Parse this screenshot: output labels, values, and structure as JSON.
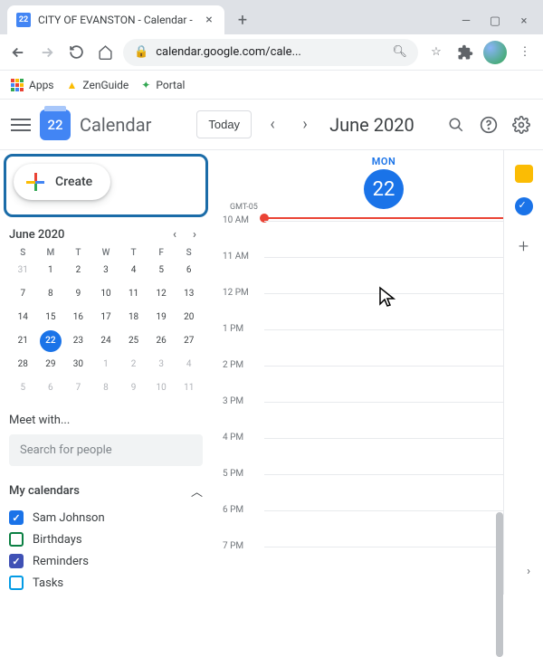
{
  "browser": {
    "tab_title": "CITY OF EVANSTON - Calendar -",
    "favicon_day": "22",
    "url_display": "calendar.google.com/cale...",
    "bookmarks": {
      "apps": "Apps",
      "zenguide": "ZenGuide",
      "portal": "Portal"
    }
  },
  "header": {
    "logo_day": "22",
    "app_name": "Calendar",
    "today_label": "Today",
    "month_label": "June 2020"
  },
  "mini": {
    "month": "June 2020",
    "dows": [
      "S",
      "M",
      "T",
      "W",
      "T",
      "F",
      "S"
    ],
    "weeks": [
      [
        {
          "n": "31",
          "o": true
        },
        {
          "n": "1"
        },
        {
          "n": "2"
        },
        {
          "n": "3"
        },
        {
          "n": "4"
        },
        {
          "n": "5"
        },
        {
          "n": "6"
        }
      ],
      [
        {
          "n": "7"
        },
        {
          "n": "8"
        },
        {
          "n": "9"
        },
        {
          "n": "10"
        },
        {
          "n": "11"
        },
        {
          "n": "12"
        },
        {
          "n": "13"
        }
      ],
      [
        {
          "n": "14"
        },
        {
          "n": "15"
        },
        {
          "n": "16"
        },
        {
          "n": "17"
        },
        {
          "n": "18"
        },
        {
          "n": "19"
        },
        {
          "n": "20"
        }
      ],
      [
        {
          "n": "21"
        },
        {
          "n": "22",
          "t": true
        },
        {
          "n": "23"
        },
        {
          "n": "24"
        },
        {
          "n": "25"
        },
        {
          "n": "26"
        },
        {
          "n": "27"
        }
      ],
      [
        {
          "n": "28"
        },
        {
          "n": "29"
        },
        {
          "n": "30"
        },
        {
          "n": "1",
          "o": true
        },
        {
          "n": "2",
          "o": true
        },
        {
          "n": "3",
          "o": true
        },
        {
          "n": "4",
          "o": true
        }
      ],
      [
        {
          "n": "5",
          "o": true
        },
        {
          "n": "6",
          "o": true
        },
        {
          "n": "7",
          "o": true
        },
        {
          "n": "8",
          "o": true
        },
        {
          "n": "9",
          "o": true
        },
        {
          "n": "10",
          "o": true
        },
        {
          "n": "11",
          "o": true
        }
      ]
    ]
  },
  "create_label": "Create",
  "meet_label": "Meet with...",
  "search_placeholder": "Search for people",
  "mycal_label": "My calendars",
  "calendars": [
    {
      "name": "Sam Johnson",
      "color": "#1a73e8",
      "checked": true
    },
    {
      "name": "Birthdays",
      "color": "#0b8043",
      "checked": false
    },
    {
      "name": "Reminders",
      "color": "#3f51b5",
      "checked": true
    },
    {
      "name": "Tasks",
      "color": "#039be5",
      "checked": false
    }
  ],
  "day": {
    "dow": "MON",
    "num": "22",
    "tz": "GMT-05",
    "hours": [
      "10 AM",
      "11 AM",
      "12 PM",
      "1 PM",
      "2 PM",
      "3 PM",
      "4 PM",
      "5 PM",
      "6 PM",
      "7 PM"
    ]
  }
}
